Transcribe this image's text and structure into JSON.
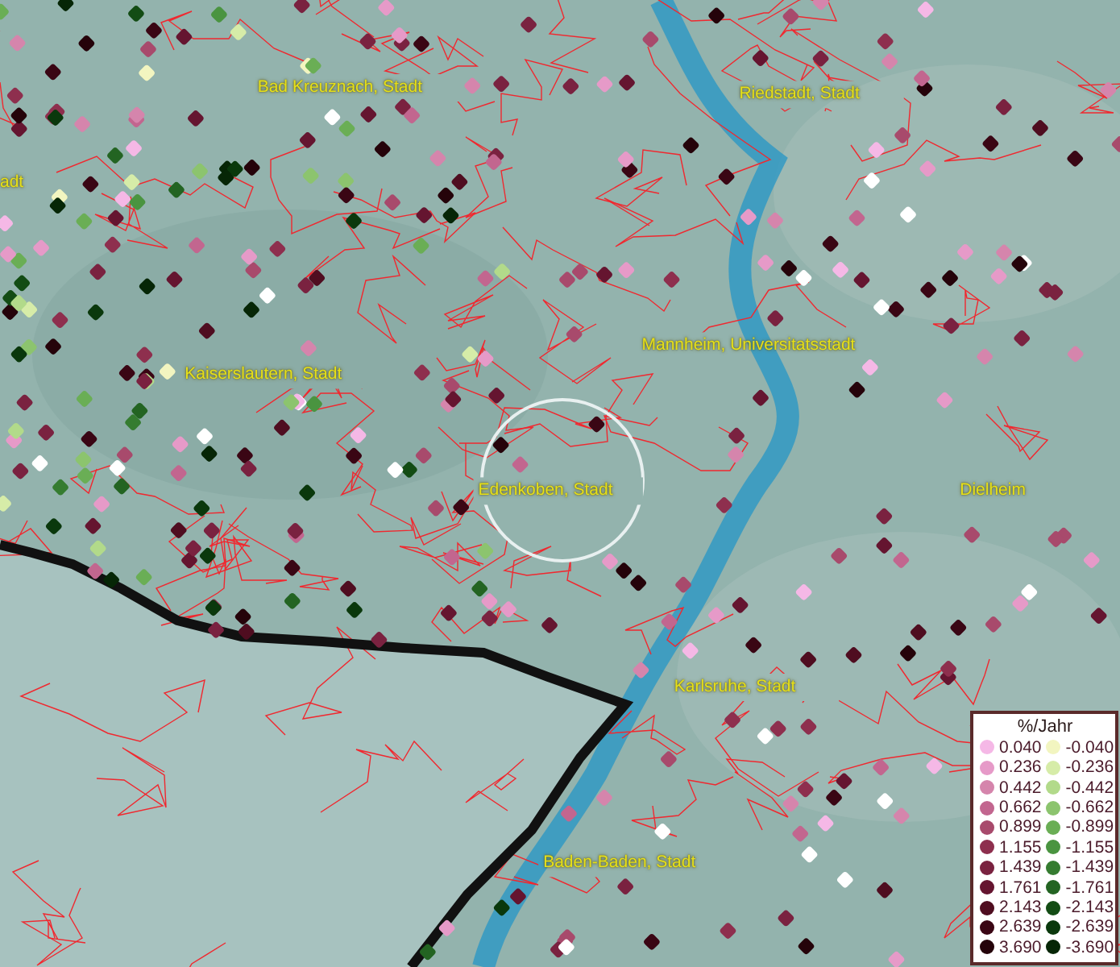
{
  "map": {
    "place_labels": [
      {
        "name": "Bad Kreuznach, Stadt"
      },
      {
        "name": "Riedstadt, Stadt"
      },
      {
        "name": "adt"
      },
      {
        "name": "Kaiserslautern, Stadt"
      },
      {
        "name": "Mannheim, Universitatsstadt"
      },
      {
        "name": "Edenkoben, Stadt"
      },
      {
        "name": "Dielheim"
      },
      {
        "name": "Karlsruhe, Stadt"
      },
      {
        "name": "Baden-Baden, Stadt"
      }
    ]
  },
  "legend": {
    "title": "%/Jahr",
    "positive": [
      {
        "value": "0.040",
        "color": "#f5b8e6"
      },
      {
        "value": "0.236",
        "color": "#e69ac8"
      },
      {
        "value": "0.442",
        "color": "#d585ac"
      },
      {
        "value": "0.662",
        "color": "#c2668f"
      },
      {
        "value": "0.899",
        "color": "#a84a6c"
      },
      {
        "value": "1.155",
        "color": "#8e2f4e"
      },
      {
        "value": "1.439",
        "color": "#7a2240"
      },
      {
        "value": "1.761",
        "color": "#651530"
      },
      {
        "value": "2.143",
        "color": "#4f0d20"
      },
      {
        "value": "2.639",
        "color": "#3a0614"
      },
      {
        "value": "3.690",
        "color": "#25030a"
      }
    ],
    "negative": [
      {
        "value": "-0.040",
        "color": "#f2f5c0"
      },
      {
        "value": "-0.236",
        "color": "#d6eca8"
      },
      {
        "value": "-0.442",
        "color": "#b2da8a"
      },
      {
        "value": "-0.662",
        "color": "#8cc46e"
      },
      {
        "value": "-0.899",
        "color": "#6aae55"
      },
      {
        "value": "-1.155",
        "color": "#4a9440"
      },
      {
        "value": "-1.439",
        "color": "#357c30"
      },
      {
        "value": "-1.761",
        "color": "#236422"
      },
      {
        "value": "-2.143",
        "color": "#134c14"
      },
      {
        "value": "-2.639",
        "color": "#0a380c"
      },
      {
        "value": "-3.690",
        "color": "#062606"
      }
    ]
  }
}
